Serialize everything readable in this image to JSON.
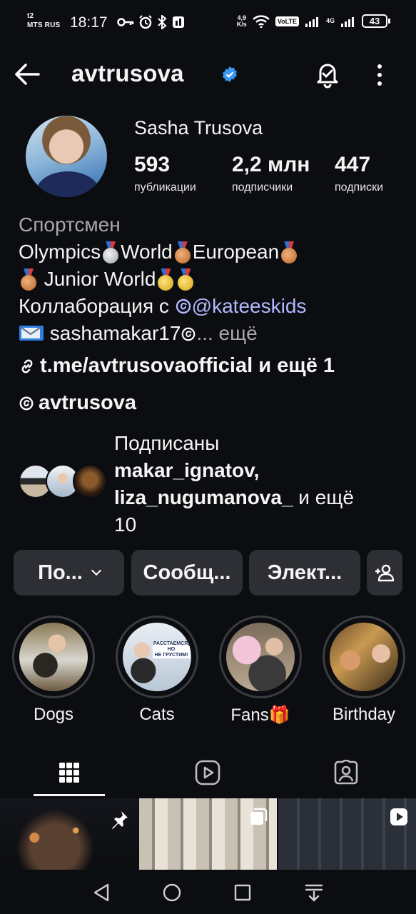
{
  "status_bar": {
    "carrier_top": "t2",
    "carrier_bottom": "MTS RUS",
    "time": "18:17",
    "net_speed_top": "4,9",
    "net_speed_bottom": "K/s",
    "volte": "VoLTE",
    "network_type": "4G",
    "battery": "43"
  },
  "header": {
    "username": "avtrusova",
    "verified": true,
    "icons": [
      "back-arrow-icon",
      "verified-badge-icon",
      "notification-bell-icon",
      "more-vertical-icon"
    ]
  },
  "profile": {
    "full_name": "Sasha Trusova",
    "stats": [
      {
        "value": "593",
        "label": "публикации"
      },
      {
        "value": "2,2 млн",
        "label": "подписчики"
      },
      {
        "value": "447",
        "label": "подписки"
      }
    ],
    "category": "Спортсмен",
    "bio_line1": {
      "a": "Olympics",
      "b": "World",
      "c": "European"
    },
    "bio_line2": {
      "a": "Junior World"
    },
    "collab_prefix": "Коллаборация с ",
    "collab_mention": "@kateeskids",
    "email_text": "sashamakar17",
    "more_label": "... ещё",
    "link_text": "t.me/avtrusovaofficial и ещё 1",
    "threads_handle": "avtrusova"
  },
  "followed_by": {
    "prefix": "Подписаны",
    "user1": "makar_ignatov,",
    "user2": "liza_nugumanova_",
    "suffix": " и ещё",
    "count": "10"
  },
  "buttons": {
    "follow": "По...",
    "message": "Сообщ...",
    "email": "Элект..."
  },
  "highlights": [
    {
      "label": "Dogs"
    },
    {
      "label": "Cats"
    },
    {
      "label": "Fans🎁"
    },
    {
      "label": "Birthday"
    }
  ],
  "story_text": {
    "line1": "РАССТАЕМСЯ,",
    "line2": "НО",
    "line3": "НЕ ГРУСТИМ!"
  },
  "tabs": [
    "grid-icon",
    "reels-icon",
    "tagged-icon"
  ],
  "colors": {
    "background": "#0c0d10",
    "button": "#2d2f34",
    "mention": "#b3b8ff",
    "muted": "#a8a8a8",
    "verified": "#3897f0"
  }
}
